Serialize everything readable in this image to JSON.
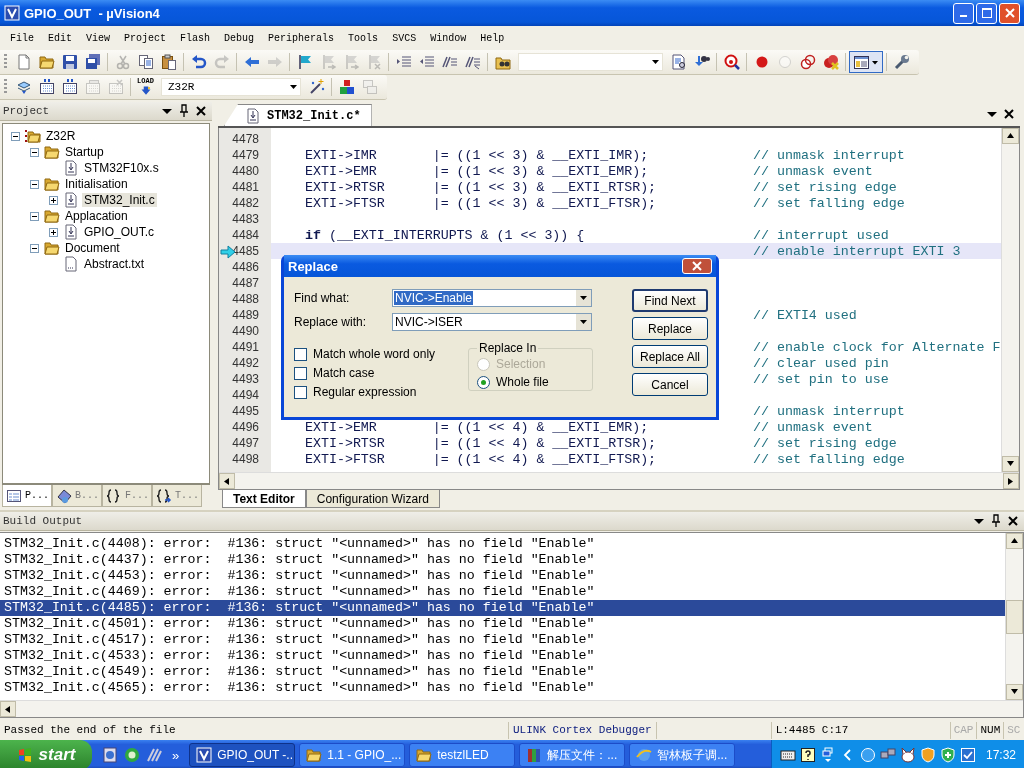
{
  "window": {
    "title": "GPIO_OUT  - µVision4"
  },
  "menu": [
    "File",
    "Edit",
    "View",
    "Project",
    "Flash",
    "Debug",
    "Peripherals",
    "Tools",
    "SVCS",
    "Window",
    "Help"
  ],
  "toolbar_1": [
    {
      "kind": "button",
      "disabled": false,
      "pressed": false
    },
    {
      "kind": "button",
      "disabled": false,
      "pressed": false
    },
    {
      "kind": "button",
      "disabled": false,
      "pressed": false
    },
    {
      "kind": "button",
      "disabled": false,
      "pressed": false
    },
    {
      "kind": "separator"
    },
    {
      "kind": "button",
      "disabled": true,
      "pressed": false
    },
    {
      "kind": "button",
      "disabled": false,
      "pressed": false
    },
    {
      "kind": "button",
      "disabled": false,
      "pressed": false
    },
    {
      "kind": "separator"
    },
    {
      "kind": "button",
      "disabled": false,
      "pressed": false
    },
    {
      "kind": "button",
      "disabled": true,
      "pressed": false
    },
    {
      "kind": "separator"
    },
    {
      "kind": "button",
      "disabled": false,
      "pressed": false
    },
    {
      "kind": "button",
      "disabled": true,
      "pressed": false
    },
    {
      "kind": "separator"
    },
    {
      "kind": "button",
      "disabled": false,
      "pressed": false
    },
    {
      "kind": "button",
      "disabled": true,
      "pressed": false
    },
    {
      "kind": "button",
      "disabled": true,
      "pressed": false
    },
    {
      "kind": "button",
      "disabled": true,
      "pressed": false
    },
    {
      "kind": "separator"
    },
    {
      "kind": "button",
      "disabled": false,
      "pressed": false
    },
    {
      "kind": "button",
      "disabled": false,
      "pressed": false
    },
    {
      "kind": "button",
      "disabled": false,
      "pressed": false
    },
    {
      "kind": "button",
      "disabled": false,
      "pressed": false
    },
    {
      "kind": "separator"
    },
    {
      "kind": "button",
      "disabled": false,
      "pressed": false
    },
    {
      "kind": "combo"
    },
    {
      "kind": "button",
      "disabled": false,
      "pressed": false
    },
    {
      "kind": "button",
      "disabled": false,
      "pressed": false
    },
    {
      "kind": "separator"
    },
    {
      "kind": "button",
      "disabled": false,
      "pressed": false
    },
    {
      "kind": "separator"
    },
    {
      "kind": "button",
      "disabled": false,
      "pressed": false
    },
    {
      "kind": "button",
      "disabled": true,
      "pressed": false
    },
    {
      "kind": "button",
      "disabled": false,
      "pressed": false
    },
    {
      "kind": "button",
      "disabled": false,
      "pressed": false
    },
    {
      "kind": "separator"
    },
    {
      "kind": "button",
      "disabled": false,
      "pressed": true
    },
    {
      "kind": "separator"
    },
    {
      "kind": "button",
      "disabled": false,
      "pressed": false
    }
  ],
  "toolbar_2": [
    {
      "kind": "button",
      "disabled": false,
      "pressed": false
    },
    {
      "kind": "button",
      "disabled": false,
      "pressed": false
    },
    {
      "kind": "button",
      "disabled": false,
      "pressed": false
    },
    {
      "kind": "button",
      "disabled": true,
      "pressed": false
    },
    {
      "kind": "button",
      "disabled": true,
      "pressed": false
    },
    {
      "kind": "separator"
    },
    {
      "kind": "button",
      "label": "LOAD",
      "disabled": false,
      "pressed": false
    },
    {
      "kind": "combo",
      "value": "Z32R"
    },
    {
      "kind": "button",
      "disabled": false,
      "pressed": false
    },
    {
      "kind": "separator"
    },
    {
      "kind": "button",
      "disabled": false,
      "pressed": false
    },
    {
      "kind": "button",
      "disabled": true,
      "pressed": false
    }
  ],
  "project_panel": {
    "title": "Project",
    "tree": [
      {
        "label": "Z32R",
        "kind": "project",
        "has_expander": true,
        "expanded": true,
        "selected": false,
        "children": [
          {
            "label": "Startup",
            "kind": "folder",
            "has_expander": true,
            "expanded": true,
            "selected": false,
            "children": [
              {
                "label": "STM32F10x.s",
                "kind": "source",
                "has_expander": false,
                "selected": false
              }
            ]
          },
          {
            "label": "Initialisation",
            "kind": "folder",
            "has_expander": true,
            "expanded": true,
            "selected": false,
            "children": [
              {
                "label": "STM32_Init.c",
                "kind": "source",
                "has_expander": true,
                "selected": true
              }
            ]
          },
          {
            "label": "Applacation",
            "kind": "folder",
            "has_expander": true,
            "expanded": true,
            "selected": false,
            "children": [
              {
                "label": "GPIO_OUT.c",
                "kind": "source",
                "has_expander": true,
                "selected": false
              }
            ]
          },
          {
            "label": "Document",
            "kind": "folder",
            "has_expander": true,
            "expanded": true,
            "selected": false,
            "children": [
              {
                "label": "Abstract.txt",
                "kind": "text",
                "has_expander": false,
                "selected": false
              }
            ]
          }
        ]
      }
    ],
    "tabs": [
      {
        "label": "P...",
        "selected": true
      },
      {
        "label": "B...",
        "selected": false
      },
      {
        "label": "F...",
        "selected": false
      },
      {
        "label": "T...",
        "selected": false
      }
    ]
  },
  "editor": {
    "tab": {
      "label": "STM32_Init.c*",
      "selected": true
    },
    "lines": [
      {
        "number": "4478",
        "current": false
      },
      {
        "number": "4479",
        "code": "EXTI->IMR       |= ((1 << 3) & __EXTI_IMR);",
        "comment": "// unmask interrupt",
        "current": false
      },
      {
        "number": "4480",
        "code": "EXTI->EMR       |= ((1 << 3) & __EXTI_EMR);",
        "comment": "// unmask event",
        "current": false
      },
      {
        "number": "4481",
        "code": "EXTI->RTSR      |= ((1 << 3) & __EXTI_RTSR);",
        "comment": "// set rising edge",
        "current": false
      },
      {
        "number": "4482",
        "code": "EXTI->FTSR      |= ((1 << 3) & __EXTI_FTSR);",
        "comment": "// set falling edge",
        "current": false
      },
      {
        "number": "4483",
        "current": false
      },
      {
        "number": "4484",
        "code": "**if** (__EXTI_INTERRUPTS & (1 << 3)) {",
        "comment": "// interrupt used",
        "current": false
      },
      {
        "number": "4485",
        "comment": "// enable interrupt EXTI 3",
        "current": true
      },
      {
        "number": "4486",
        "current": false
      },
      {
        "number": "4487",
        "current": false
      },
      {
        "number": "4488",
        "current": false
      },
      {
        "number": "4489",
        "comment": "// EXTI4 used",
        "current": false
      },
      {
        "number": "4490",
        "current": false
      },
      {
        "number": "4491",
        "comment": "// enable clock for Alternate F",
        "current": false
      },
      {
        "number": "4492",
        "comment": "// clear used pin",
        "current": false
      },
      {
        "number": "4493",
        "comment": "// set pin to use",
        "current": false
      },
      {
        "number": "4494",
        "current": false
      },
      {
        "number": "4495",
        "comment": "// unmask interrupt",
        "current": false
      },
      {
        "number": "4496",
        "code": "EXTI->EMR       |= ((1 << 4) & __EXTI_EMR);",
        "comment": "// unmask event",
        "current": false
      },
      {
        "number": "4497",
        "code": "EXTI->RTSR      |= ((1 << 4) & __EXTI_RTSR);",
        "comment": "// set rising edge",
        "current": false
      },
      {
        "number": "4498",
        "code": "EXTI->FTSR      |= ((1 << 4) & __EXTI_FTSR);",
        "comment": "// set falling edge",
        "current": false
      }
    ],
    "bottom_tabs": [
      {
        "label": "Text Editor",
        "selected": true
      },
      {
        "label": "Configuration Wizard",
        "selected": false
      }
    ]
  },
  "replace_dialog": {
    "title": "Replace",
    "find_label": "Find what:",
    "find_value": "NVIC->Enable",
    "text_selected": true,
    "replace_label": "Replace with:",
    "replace_value": "NVIC->ISER",
    "options": [
      {
        "label": "Match whole word only",
        "checked": false
      },
      {
        "label": "Match case",
        "checked": false
      },
      {
        "label": "Regular expression",
        "checked": false
      }
    ],
    "scope": {
      "title": "Replace In",
      "options": [
        {
          "label": "Selection",
          "selected": false,
          "disabled": true
        },
        {
          "label": "Whole file",
          "selected": true,
          "disabled": false
        }
      ]
    },
    "buttons": [
      {
        "label": "Find Next",
        "default": true
      },
      {
        "label": "Replace",
        "default": false
      },
      {
        "label": "Replace All",
        "default": false
      },
      {
        "label": "Cancel",
        "default": false
      }
    ]
  },
  "build_output": {
    "title": "Build Output",
    "rows": [
      {
        "text": "STM32_Init.c(4408): error:  #136: struct \"<unnamed>\" has no field \"Enable\"",
        "selected": false
      },
      {
        "text": "STM32_Init.c(4437): error:  #136: struct \"<unnamed>\" has no field \"Enable\"",
        "selected": false
      },
      {
        "text": "STM32_Init.c(4453): error:  #136: struct \"<unnamed>\" has no field \"Enable\"",
        "selected": false
      },
      {
        "text": "STM32_Init.c(4469): error:  #136: struct \"<unnamed>\" has no field \"Enable\"",
        "selected": false
      },
      {
        "text": "STM32_Init.c(4485): error:  #136: struct \"<unnamed>\" has no field \"Enable\"",
        "selected": true
      },
      {
        "text": "STM32_Init.c(4501): error:  #136: struct \"<unnamed>\" has no field \"Enable\"",
        "selected": false
      },
      {
        "text": "STM32_Init.c(4517): error:  #136: struct \"<unnamed>\" has no field \"Enable\"",
        "selected": false
      },
      {
        "text": "STM32_Init.c(4533): error:  #136: struct \"<unnamed>\" has no field \"Enable\"",
        "selected": false
      },
      {
        "text": "STM32_Init.c(4549): error:  #136: struct \"<unnamed>\" has no field \"Enable\"",
        "selected": false
      },
      {
        "text": "STM32_Init.c(4565): error:  #136: struct \"<unnamed>\" has no field \"Enable\"",
        "selected": false
      }
    ]
  },
  "status_bar": {
    "message": "Passed the end of the file",
    "debugger": "ULINK Cortex Debugger",
    "position": "L:4485 C:17",
    "indicators": [
      {
        "label": "CAP",
        "on": false
      },
      {
        "label": "NUM",
        "on": true
      },
      {
        "label": "SC",
        "on": false
      }
    ]
  },
  "taskbar": {
    "start": "start",
    "more": "»",
    "tasks": [
      {
        "label": "GPIO_OUT -...",
        "selected": true
      },
      {
        "label": "1.1 - GPIO_...",
        "selected": false
      },
      {
        "label": "testzlLED",
        "selected": false
      },
      {
        "label": "解压文件：...",
        "selected": false
      },
      {
        "label": "智林板子调...",
        "selected": false
      }
    ],
    "clock": "17:32"
  }
}
